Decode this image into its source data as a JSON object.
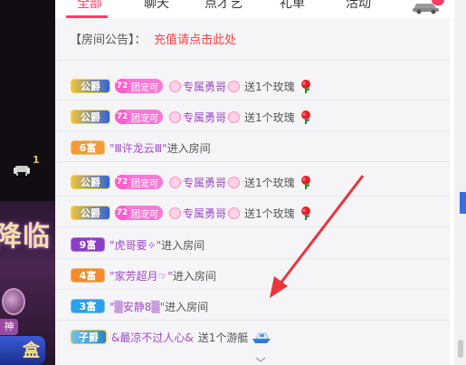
{
  "tabs": [
    "全部",
    "聊天",
    "点才艺",
    "礼单",
    "活动"
  ],
  "notice": {
    "label": "【房间公告】：",
    "link": "充值请点击此处"
  },
  "stage": {
    "title": "降临",
    "seat_count": "1",
    "name_tag": "神",
    "box_label": "盒"
  },
  "messages": [
    {
      "badge": "公爵",
      "badge_style": "gong",
      "fan_level": "72",
      "fan_name": "团宠可",
      "user": "专属勇哥",
      "action": "送1个玫瑰",
      "gift": "rose"
    },
    {
      "badge": "公爵",
      "badge_style": "gong",
      "fan_level": "72",
      "fan_name": "团宠可",
      "user": "专属勇哥",
      "action": "送1个玫瑰",
      "gift": "rose"
    },
    {
      "badge": "6富",
      "badge_style": "fu6",
      "quote_user": "\"Ⅲ许龙云Ⅲ\"",
      "action": "进入房间"
    },
    {
      "badge": "公爵",
      "badge_style": "gong",
      "fan_level": "72",
      "fan_name": "团宠可",
      "user": "专属勇哥",
      "action": "送1个玫瑰",
      "gift": "rose"
    },
    {
      "badge": "公爵",
      "badge_style": "gong",
      "fan_level": "72",
      "fan_name": "团宠可",
      "user": "专属勇哥",
      "action": "送1个玫瑰",
      "gift": "rose"
    },
    {
      "badge": "9富",
      "badge_style": "fu9",
      "quote_user": "\"虎哥要✧\"",
      "action": "进入房间"
    },
    {
      "badge": "4富",
      "badge_style": "fu4",
      "quote_user": "\"家芳超月☞\"",
      "action": "进入房间"
    },
    {
      "badge": "3富",
      "badge_style": "fu3",
      "quote_user": "\"▒安静8▒\"",
      "action": "进入房间"
    },
    {
      "badge": "子爵",
      "badge_style": "zi",
      "user": "&最凉不过人心&",
      "action": "送1个游艇",
      "gift": "boat"
    }
  ]
}
